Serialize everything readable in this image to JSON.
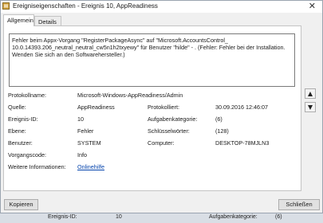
{
  "window": {
    "title": "Ereigniseigenschaften - Ereignis 10, AppReadiness",
    "close_glyph": "✕"
  },
  "tabs": [
    {
      "label": "Allgemein",
      "active": true
    },
    {
      "label": "Details",
      "active": false
    }
  ],
  "message": "Fehler beim Appx-Vorgang \"RegisterPackageAsync\" auf \"Microsoft.AccountsControl_ 10.0.14393.206_neutral_neutral_cw5n1h2txyewy\" für Benutzer \"hilde\" - . (Fehler: Fehler bei der Installation. Wenden Sie sich an den Softwarehersteller.)",
  "fields": {
    "protokollname": {
      "label": "Protokollname:",
      "value": "Microsoft-Windows-AppReadiness/Admin"
    },
    "quelle": {
      "label": "Quelle:",
      "value": "AppReadiness"
    },
    "protokolliert": {
      "label": "Protokolliert:",
      "value": "30.09.2016 12:46:07"
    },
    "ereignis_id": {
      "label": "Ereignis-ID:",
      "value": "10"
    },
    "aufgabenkategorie": {
      "label": "Aufgabenkategorie:",
      "value": "(6)"
    },
    "ebene": {
      "label": "Ebene:",
      "value": "Fehler"
    },
    "schluesselwoerter": {
      "label": "Schlüsselwörter:",
      "value": "(128)"
    },
    "benutzer": {
      "label": "Benutzer:",
      "value": "SYSTEM"
    },
    "computer": {
      "label": "Computer:",
      "value": "DESKTOP-78MJLN3"
    },
    "vorgangscode": {
      "label": "Vorgangscode:",
      "value": "Info"
    },
    "weitere": {
      "label": "Weitere Informationen:",
      "value": "Onlinehilfe"
    }
  },
  "nav": {
    "up_icon": "arrow-up-icon",
    "down_icon": "arrow-down-icon"
  },
  "buttons": {
    "copy": "Kopieren",
    "close": "Schließen"
  },
  "background_row": {
    "label": "Ereignis-ID:",
    "value": "10",
    "label2": "Aufgabenkategorie:",
    "value2": "(6)"
  }
}
